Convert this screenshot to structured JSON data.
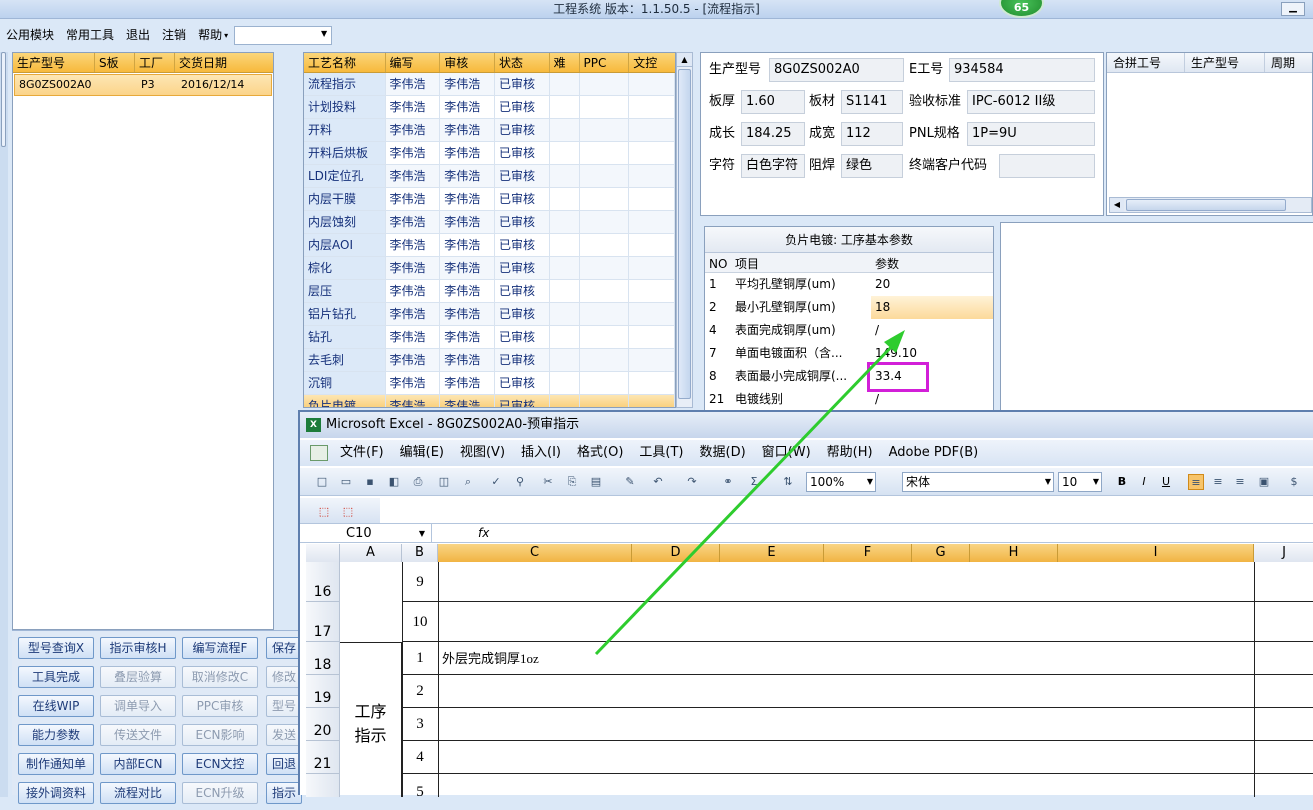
{
  "window": {
    "title": "工程系统    版本：1.1.50.5 - [流程指示]",
    "badge": "65",
    "min_btn": "▁"
  },
  "menubar": {
    "items": [
      "公用模块",
      "常用工具",
      "退出",
      "注销",
      "帮助"
    ],
    "dropdown": "▾"
  },
  "orders": {
    "headers": [
      "生产型号",
      "S板",
      "工厂",
      "交货日期"
    ],
    "rows": [
      {
        "model": "8G0ZS002A0",
        "s": "",
        "factory": "P3",
        "date": "2016/12/14"
      }
    ]
  },
  "process": {
    "headers": [
      "工艺名称",
      "编写",
      "审核",
      "状态",
      "难",
      "PPC",
      "文控"
    ],
    "rows": [
      [
        "流程指示",
        "李伟浩",
        "李伟浩",
        "已审核"
      ],
      [
        "计划投料",
        "李伟浩",
        "李伟浩",
        "已审核"
      ],
      [
        "开料",
        "李伟浩",
        "李伟浩",
        "已审核"
      ],
      [
        "开料后烘板",
        "李伟浩",
        "李伟浩",
        "已审核"
      ],
      [
        "LDI定位孔",
        "李伟浩",
        "李伟浩",
        "已审核"
      ],
      [
        "内层干膜",
        "李伟浩",
        "李伟浩",
        "已审核"
      ],
      [
        "内层蚀刻",
        "李伟浩",
        "李伟浩",
        "已审核"
      ],
      [
        "内层AOI",
        "李伟浩",
        "李伟浩",
        "已审核"
      ],
      [
        "棕化",
        "李伟浩",
        "李伟浩",
        "已审核"
      ],
      [
        "层压",
        "李伟浩",
        "李伟浩",
        "已审核"
      ],
      [
        "铝片钻孔",
        "李伟浩",
        "李伟浩",
        "已审核"
      ],
      [
        "钻孔",
        "李伟浩",
        "李伟浩",
        "已审核"
      ],
      [
        "去毛刺",
        "李伟浩",
        "李伟浩",
        "已审核"
      ],
      [
        "沉铜",
        "李伟浩",
        "李伟浩",
        "已审核"
      ],
      [
        "负片电镀",
        "李伟浩",
        "李伟浩",
        "已审核"
      ]
    ]
  },
  "info": {
    "model_label": "生产型号",
    "model": "8G0ZS002A0",
    "eno_label": "E工号",
    "eno": "934584",
    "thick_label": "板厚",
    "thick": "1.60",
    "mat_label": "板材",
    "mat": "S1141",
    "std_label": "验收标准",
    "std": "IPC-6012 II级",
    "len_label": "成长",
    "len": "184.25",
    "wid_label": "成宽",
    "wid": "112",
    "pnl_label": "PNL规格",
    "pnl": "1P=9U",
    "char_label": "字符",
    "char": "白色字符",
    "mask_label": "阻焊",
    "mask": "绿色",
    "cust_label": "终端客户代码",
    "cust": ""
  },
  "merge": {
    "headers": [
      "合拼工号",
      "生产型号",
      "周期"
    ]
  },
  "params": {
    "caption": "负片电镀: 工序基本参数",
    "headers": [
      "NO",
      "项目",
      "参数"
    ],
    "rows": [
      [
        "1",
        "平均孔壁铜厚(um)",
        "20"
      ],
      [
        "2",
        "最小孔壁铜厚(um)",
        "18"
      ],
      [
        "4",
        "表面完成铜厚(um)",
        "/"
      ],
      [
        "7",
        "单面电镀面积（含...",
        "149.10"
      ],
      [
        "8",
        "表面最小完成铜厚(...",
        "33.4"
      ],
      [
        "21",
        "电镀线别",
        "/"
      ]
    ]
  },
  "buttons": [
    [
      "型号查询X",
      "指示审核H",
      "编写流程F",
      "保存"
    ],
    [
      "工具完成",
      "叠层验算",
      "取消修改C",
      "修改"
    ],
    [
      "在线WIP",
      "调单导入",
      "PPC审核",
      "型号"
    ],
    [
      "能力参数",
      "传送文件",
      "ECN影响",
      "发送"
    ],
    [
      "制作通知单",
      "内部ECN",
      "ECN文控",
      "回退"
    ],
    [
      "接外调资料",
      "流程对比",
      "ECN升级",
      "指示"
    ]
  ],
  "excel": {
    "title": "Microsoft Excel - 8G0ZS002A0-预审指示",
    "menu": [
      "文件(F)",
      "编辑(E)",
      "视图(V)",
      "插入(I)",
      "格式(O)",
      "工具(T)",
      "数据(D)",
      "窗口(W)",
      "帮助(H)",
      "Adobe PDF(B)"
    ],
    "zoom": "100%",
    "font": "宋体",
    "font_size": "10",
    "namebox": "C10",
    "fx": "fx",
    "columns": [
      "A",
      "B",
      "C",
      "D",
      "E",
      "F",
      "G",
      "H",
      "I",
      "J"
    ],
    "rows": [
      {
        "num": "16",
        "b": "9",
        "c": ""
      },
      {
        "num": "17",
        "b": "10",
        "c": ""
      },
      {
        "num": "18",
        "b": "1",
        "c": "外层完成铜厚1oz"
      },
      {
        "num": "19",
        "b": "2",
        "c": ""
      },
      {
        "num": "20",
        "b": "3",
        "c": ""
      },
      {
        "num": "21",
        "b": "4",
        "c": ""
      }
    ],
    "merged_a": "工序\n指示",
    "partial_b": "5"
  },
  "colors": {
    "accent_orange": "#f7b93c",
    "arrow": "#2ecc2e",
    "highlight_box": "#d21fd8"
  }
}
